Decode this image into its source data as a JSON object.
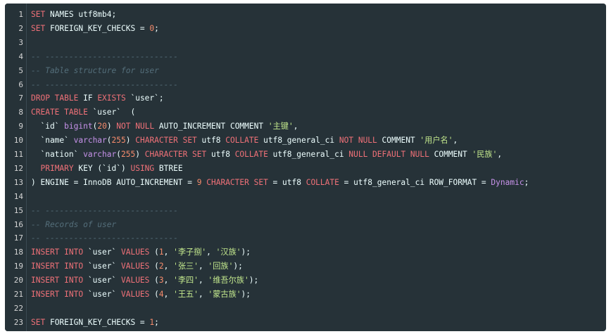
{
  "editor": {
    "lines": [
      {
        "n": "1",
        "tokens": [
          [
            "kw",
            "SET"
          ],
          [
            "plain",
            " NAMES utf8mb4;"
          ]
        ]
      },
      {
        "n": "2",
        "tokens": [
          [
            "kw",
            "SET"
          ],
          [
            "plain",
            " FOREIGN_KEY_CHECKS = "
          ],
          [
            "num",
            "0"
          ],
          [
            "plain",
            ";"
          ]
        ]
      },
      {
        "n": "3",
        "tokens": []
      },
      {
        "n": "4",
        "tokens": [
          [
            "cm",
            "-- ----------------------------"
          ]
        ]
      },
      {
        "n": "5",
        "tokens": [
          [
            "cm",
            "-- Table structure for user"
          ]
        ]
      },
      {
        "n": "6",
        "tokens": [
          [
            "cm",
            "-- ----------------------------"
          ]
        ]
      },
      {
        "n": "7",
        "tokens": [
          [
            "kw",
            "DROP TABLE"
          ],
          [
            "plain",
            " IF "
          ],
          [
            "kw",
            "EXISTS"
          ],
          [
            "plain",
            " `user`;"
          ]
        ]
      },
      {
        "n": "8",
        "tokens": [
          [
            "kw",
            "CREATE TABLE"
          ],
          [
            "plain",
            " `user`  ("
          ]
        ]
      },
      {
        "n": "9",
        "tokens": [
          [
            "plain",
            "  `id` "
          ],
          [
            "kw2",
            "bigint"
          ],
          [
            "plain",
            "("
          ],
          [
            "num",
            "20"
          ],
          [
            "plain",
            ") "
          ],
          [
            "kw",
            "NOT NULL"
          ],
          [
            "plain",
            " AUTO_INCREMENT COMMENT "
          ],
          [
            "str",
            "'主键'"
          ],
          [
            "plain",
            ","
          ]
        ]
      },
      {
        "n": "10",
        "tokens": [
          [
            "plain",
            "  `name` "
          ],
          [
            "kw2",
            "varchar"
          ],
          [
            "plain",
            "("
          ],
          [
            "num",
            "255"
          ],
          [
            "plain",
            ") "
          ],
          [
            "kw",
            "CHARACTER SET"
          ],
          [
            "plain",
            " utf8 "
          ],
          [
            "kw",
            "COLLATE"
          ],
          [
            "plain",
            " utf8_general_ci "
          ],
          [
            "kw",
            "NOT NULL"
          ],
          [
            "plain",
            " COMMENT "
          ],
          [
            "str",
            "'用户名'"
          ],
          [
            "plain",
            ","
          ]
        ]
      },
      {
        "n": "11",
        "tokens": [
          [
            "plain",
            "  `nation` "
          ],
          [
            "kw2",
            "varchar"
          ],
          [
            "plain",
            "("
          ],
          [
            "num",
            "255"
          ],
          [
            "plain",
            ") "
          ],
          [
            "kw",
            "CHARACTER SET"
          ],
          [
            "plain",
            " utf8 "
          ],
          [
            "kw",
            "COLLATE"
          ],
          [
            "plain",
            " utf8_general_ci "
          ],
          [
            "kw",
            "NULL DEFAULT NULL"
          ],
          [
            "plain",
            " COMMENT "
          ],
          [
            "str",
            "'民族'"
          ],
          [
            "plain",
            ","
          ]
        ]
      },
      {
        "n": "12",
        "tokens": [
          [
            "plain",
            "  "
          ],
          [
            "kw",
            "PRIMARY"
          ],
          [
            "plain",
            " KEY (`id`) "
          ],
          [
            "kw",
            "USING"
          ],
          [
            "plain",
            " BTREE"
          ]
        ]
      },
      {
        "n": "13",
        "tokens": [
          [
            "plain",
            ") ENGINE = InnoDB AUTO_INCREMENT = "
          ],
          [
            "num",
            "9"
          ],
          [
            "plain",
            " "
          ],
          [
            "kw",
            "CHARACTER SET"
          ],
          [
            "plain",
            " = utf8 "
          ],
          [
            "kw",
            "COLLATE"
          ],
          [
            "plain",
            " = utf8_general_ci ROW_FORMAT = "
          ],
          [
            "kw2",
            "Dynamic"
          ],
          [
            "plain",
            ";"
          ]
        ]
      },
      {
        "n": "14",
        "tokens": []
      },
      {
        "n": "15",
        "tokens": [
          [
            "cm",
            "-- ----------------------------"
          ]
        ]
      },
      {
        "n": "16",
        "tokens": [
          [
            "cm",
            "-- Records of user"
          ]
        ]
      },
      {
        "n": "17",
        "tokens": [
          [
            "cm",
            "-- ----------------------------"
          ]
        ]
      },
      {
        "n": "18",
        "tokens": [
          [
            "kw",
            "INSERT INTO"
          ],
          [
            "plain",
            " `user` "
          ],
          [
            "kw",
            "VALUES"
          ],
          [
            "plain",
            " ("
          ],
          [
            "num",
            "1"
          ],
          [
            "plain",
            ", "
          ],
          [
            "str",
            "'李子捌'"
          ],
          [
            "plain",
            ", "
          ],
          [
            "str",
            "'汉族'"
          ],
          [
            "plain",
            ");"
          ]
        ]
      },
      {
        "n": "19",
        "tokens": [
          [
            "kw",
            "INSERT INTO"
          ],
          [
            "plain",
            " `user` "
          ],
          [
            "kw",
            "VALUES"
          ],
          [
            "plain",
            " ("
          ],
          [
            "num",
            "2"
          ],
          [
            "plain",
            ", "
          ],
          [
            "str",
            "'张三'"
          ],
          [
            "plain",
            ", "
          ],
          [
            "str",
            "'回族'"
          ],
          [
            "plain",
            ");"
          ]
        ]
      },
      {
        "n": "20",
        "tokens": [
          [
            "kw",
            "INSERT INTO"
          ],
          [
            "plain",
            " `user` "
          ],
          [
            "kw",
            "VALUES"
          ],
          [
            "plain",
            " ("
          ],
          [
            "num",
            "3"
          ],
          [
            "plain",
            ", "
          ],
          [
            "str",
            "'李四'"
          ],
          [
            "plain",
            ", "
          ],
          [
            "str",
            "'维吾尔族'"
          ],
          [
            "plain",
            ");"
          ]
        ]
      },
      {
        "n": "21",
        "tokens": [
          [
            "kw",
            "INSERT INTO"
          ],
          [
            "plain",
            " `user` "
          ],
          [
            "kw",
            "VALUES"
          ],
          [
            "plain",
            " ("
          ],
          [
            "num",
            "4"
          ],
          [
            "plain",
            ", "
          ],
          [
            "str",
            "'王五'"
          ],
          [
            "plain",
            ", "
          ],
          [
            "str",
            "'蒙古族'"
          ],
          [
            "plain",
            ");"
          ]
        ]
      },
      {
        "n": "22",
        "tokens": []
      },
      {
        "n": "23",
        "tokens": [
          [
            "kw",
            "SET"
          ],
          [
            "plain",
            " FOREIGN_KEY_CHECKS = "
          ],
          [
            "num",
            "1"
          ],
          [
            "plain",
            ";"
          ]
        ]
      }
    ]
  }
}
